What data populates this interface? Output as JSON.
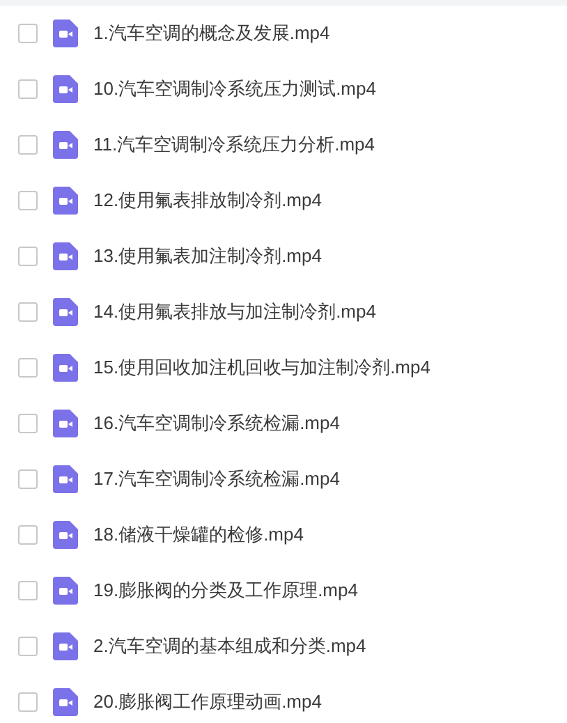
{
  "files": [
    {
      "name": "1.汽车空调的概念及发展.mp4",
      "checked": false
    },
    {
      "name": "10.汽车空调制冷系统压力测试.mp4",
      "checked": false
    },
    {
      "name": "11.汽车空调制冷系统压力分析.mp4",
      "checked": false
    },
    {
      "name": "12.使用氟表排放制冷剂.mp4",
      "checked": false
    },
    {
      "name": "13.使用氟表加注制冷剂.mp4",
      "checked": false
    },
    {
      "name": "14.使用氟表排放与加注制冷剂.mp4",
      "checked": false
    },
    {
      "name": "15.使用回收加注机回收与加注制冷剂.mp4",
      "checked": false
    },
    {
      "name": "16.汽车空调制冷系统检漏.mp4",
      "checked": false
    },
    {
      "name": "17.汽车空调制冷系统检漏.mp4",
      "checked": false
    },
    {
      "name": "18.储液干燥罐的检修.mp4",
      "checked": false
    },
    {
      "name": "19.膨胀阀的分类及工作原理.mp4",
      "checked": false
    },
    {
      "name": "2.汽车空调的基本组成和分类.mp4",
      "checked": false
    },
    {
      "name": "20.膨胀阀工作原理动画.mp4",
      "checked": false
    }
  ]
}
